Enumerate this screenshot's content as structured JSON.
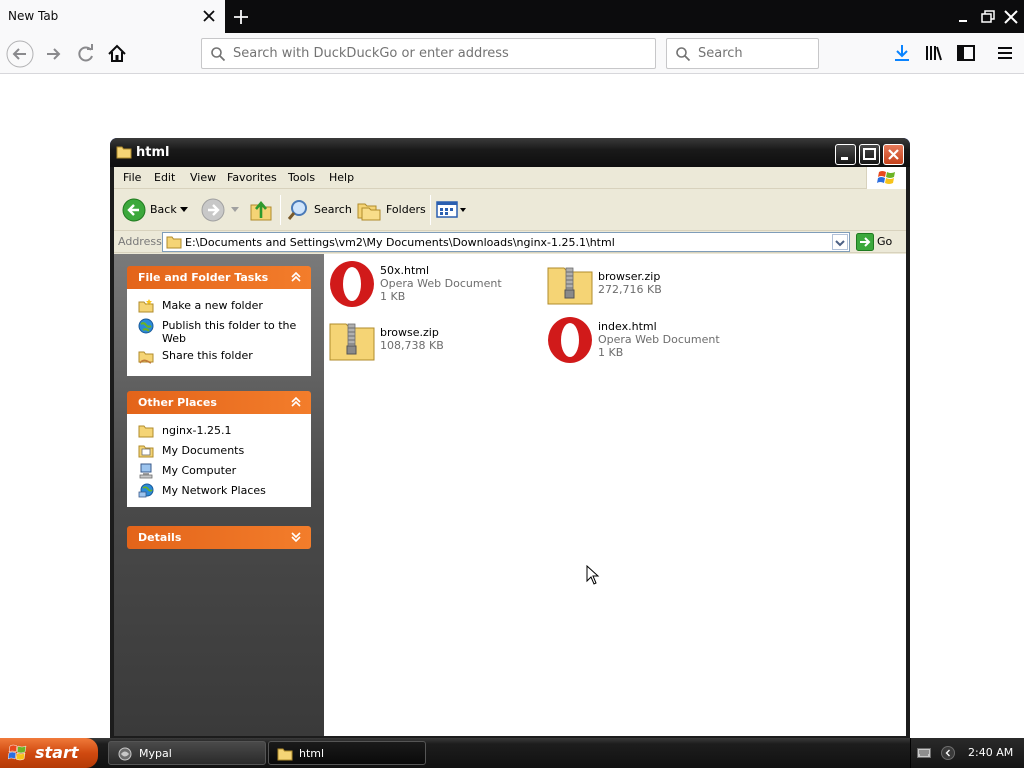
{
  "browser": {
    "tab_title": "New Tab",
    "url_placeholder": "Search with DuckDuckGo or enter address",
    "search_placeholder": "Search"
  },
  "explorer": {
    "title": "html",
    "menu": [
      "File",
      "Edit",
      "View",
      "Favorites",
      "Tools",
      "Help"
    ],
    "toolbar": {
      "back_label": "Back",
      "search_label": "Search",
      "folders_label": "Folders"
    },
    "address": {
      "label": "Address",
      "value": "E:\\Documents and Settings\\vm2\\My Documents\\Downloads\\nginx-1.25.1\\html",
      "go_label": "Go"
    },
    "tasks": {
      "header": "File and Folder Tasks",
      "items": [
        "Make a new folder",
        "Publish this folder to the Web",
        "Share this folder"
      ]
    },
    "other_places": {
      "header": "Other Places",
      "items": [
        "nginx-1.25.1",
        "My Documents",
        "My Computer",
        "My Network Places"
      ]
    },
    "details": {
      "header": "Details"
    },
    "files": [
      {
        "name": "50x.html",
        "type": "Opera Web Document",
        "size": "1 KB",
        "icon": "opera-icon"
      },
      {
        "name": "browser.zip",
        "type": "",
        "size": "272,716 KB",
        "icon": "zip-folder-icon"
      },
      {
        "name": "browse.zip",
        "type": "",
        "size": "108,738 KB",
        "icon": "zip-folder-icon"
      },
      {
        "name": "index.html",
        "type": "Opera Web Document",
        "size": "1 KB",
        "icon": "opera-icon"
      }
    ]
  },
  "taskbar": {
    "start_label": "start",
    "tasks": [
      {
        "label": "Mypal"
      },
      {
        "label": "html"
      }
    ],
    "clock": "2:40 AM"
  },
  "colors": {
    "task_header": "#e3641a",
    "opera_red": "#d11a1a"
  }
}
